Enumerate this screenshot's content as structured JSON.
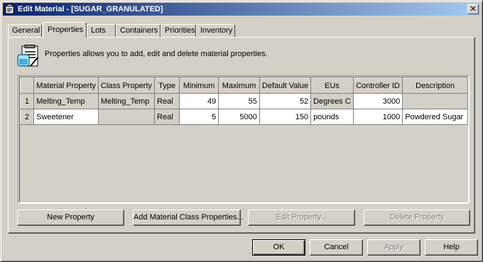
{
  "window": {
    "title": "Edit Material - [SUGAR_GRANULATED]",
    "close_glyph": "✕"
  },
  "tabs": [
    {
      "label": "General",
      "active": false
    },
    {
      "label": "Properties",
      "active": true
    },
    {
      "label": "Lots",
      "active": false
    },
    {
      "label": "Containers",
      "active": false
    },
    {
      "label": "Priorities",
      "active": false
    },
    {
      "label": "Inventory",
      "active": false
    }
  ],
  "info": {
    "icon": "properties-notepad-icon",
    "text": "Properties allows you to add, edit and delete material properties."
  },
  "grid": {
    "columns": [
      "Material Property",
      "Class Property",
      "Type",
      "Minimum",
      "Maximum",
      "Default Value",
      "EUs",
      "Controller ID",
      "Description"
    ],
    "rows": [
      {
        "num": "1",
        "material_property": "Melting_Temp",
        "class_property": "Melting_Temp",
        "type": "Real",
        "minimum": "49",
        "maximum": "55",
        "default_value": "52",
        "eus": "Degrees C",
        "controller_id": "3000",
        "description": ""
      },
      {
        "num": "2",
        "material_property": "Sweetener",
        "class_property": "",
        "type": "Real",
        "minimum": "5",
        "maximum": "5000",
        "default_value": "150",
        "eus": "pounds",
        "controller_id": "1000",
        "description": "Powdered Sugar"
      }
    ]
  },
  "actions": {
    "new_property": "New Property",
    "add_class_properties": "Add Material Class Properties...",
    "edit_property": "Edit Property...",
    "delete_property": "Delete Property"
  },
  "footer": {
    "ok": "OK",
    "cancel": "Cancel",
    "apply": "Apply",
    "help": "Help"
  },
  "colors": {
    "title_start": "#0a246a",
    "title_end": "#a6caf0",
    "face": "#d4d0c8"
  }
}
